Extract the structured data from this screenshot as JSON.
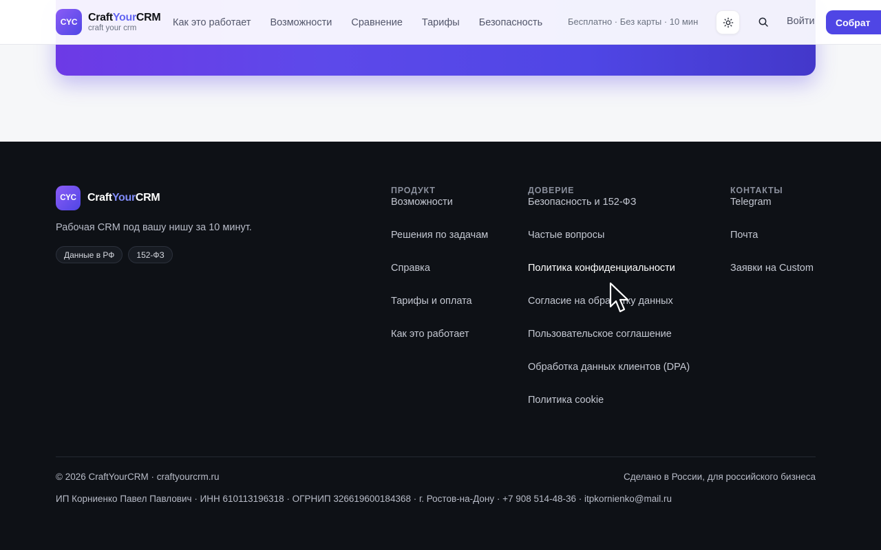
{
  "header": {
    "logo_badge": "CYC",
    "logo_name_1": "Craft",
    "logo_name_2": "Your",
    "logo_name_3": "CRM",
    "logo_sub": "craft your crm",
    "nav": [
      "Как это работает",
      "Возможности",
      "Сравнение",
      "Тарифы",
      "Безопасность"
    ],
    "promo": "Бесплатно · Без карты · 10 мин",
    "theme_icon": "sun-icon",
    "search_icon": "search-icon",
    "login_label": "Войти",
    "cta_label": "Собрат"
  },
  "footer": {
    "logo_badge": "CYC",
    "logo_name_1": "Craft",
    "logo_name_2": "Your",
    "logo_name_3": "CRM",
    "tagline": "Рабочая CRM под вашу нишу за 10 минут.",
    "badges": [
      "Данные в РФ",
      "152-ФЗ"
    ],
    "columns": [
      {
        "title": "ПРОДУКТ",
        "links": [
          "Возможности",
          "Решения по задачам",
          "Справка",
          "Тарифы и оплата",
          "Как это работает"
        ]
      },
      {
        "title": "ДОВЕРИЕ",
        "links": [
          "Безопасность и 152-ФЗ",
          "Частые вопросы",
          "Политика конфиденциальности",
          "Согласие на обработку данных",
          "Пользовательское соглашение",
          "Обработка данных клиентов (DPA)",
          "Политика cookie"
        ]
      },
      {
        "title": "КОНТАКТЫ",
        "links": [
          "Telegram",
          "Почта",
          "Заявки на Custom"
        ]
      }
    ],
    "copyright": "© 2026 CraftYourCRM · craftyourcrm.ru",
    "made_in": "Сделано в России, для российского бизнеса",
    "legal": "ИП Корниенко Павел Павлович · ИНН 610113196318 · ОГРНИП 326619600184368 · г. Ростов-на-Дону · +7 908 514-48-36 · itpkornienko@mail.ru"
  },
  "colors": {
    "accent": "#4f46e5",
    "footer_bg": "#0e1116",
    "page_bg": "#f6f7f9"
  }
}
